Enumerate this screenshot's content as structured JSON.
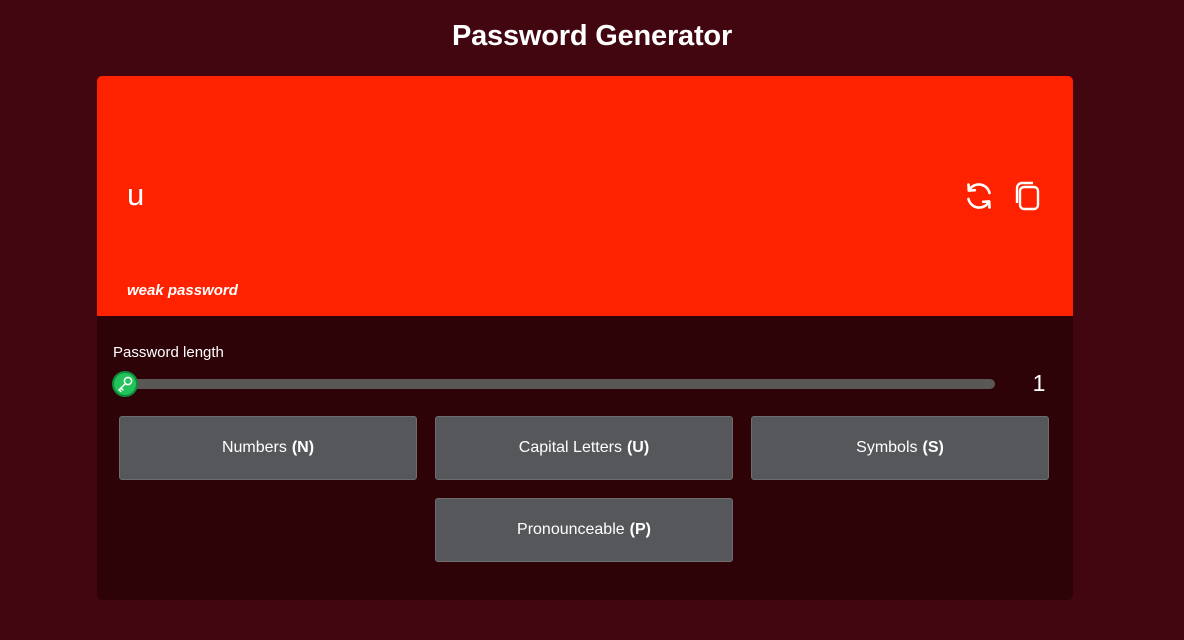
{
  "title": "Password Generator",
  "display": {
    "password": "u",
    "strength": "weak password",
    "background_color": "#ff2200"
  },
  "actions": {
    "refresh_icon": "refresh-icon",
    "copy_icon": "copy-icon"
  },
  "length": {
    "label": "Password length",
    "value": "1",
    "fraction": 0.0,
    "thumb_icon": "key-icon",
    "thumb_color": "#23c25a"
  },
  "options": {
    "numbers": {
      "label": "Numbers",
      "shortcut": "(N)"
    },
    "capitals": {
      "label": "Capital Letters",
      "shortcut": "(U)"
    },
    "symbols": {
      "label": "Symbols",
      "shortcut": "(S)"
    },
    "pronounceable": {
      "label": "Pronounceable",
      "shortcut": "(P)"
    }
  }
}
